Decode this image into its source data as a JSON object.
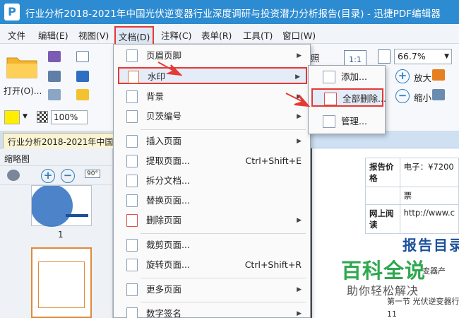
{
  "window": {
    "logo": "P",
    "title": "行业分析2018-2021年中国光伏逆变器行业深度调研与投资潜力分析报告(目录) - 迅捷PDF编辑器"
  },
  "menubar": {
    "items": [
      "文件",
      "编辑(E)",
      "视图(V)",
      "文档(D)",
      "注释(C)",
      "表单(R)",
      "工具(T)",
      "窗口(W)"
    ]
  },
  "toolbar": {
    "open_label": "打开(O)...",
    "zoom_percent": "100%",
    "zoom_level": "66.7%",
    "zoom_in_label": "放大",
    "zoom_out_label": "缩小",
    "fit_badge": "1:1",
    "partial_label": "照",
    "highlight_color": "#ffee00"
  },
  "doc_tab": {
    "label": "行业分析2018-2021年中国光"
  },
  "thumbnail_panel": {
    "title": "缩略图",
    "rotate_badge": "90°",
    "page_number": "1"
  },
  "document": {
    "table": [
      {
        "key": "报告价格",
        "value": "电子：¥7200"
      },
      {
        "key": "",
        "value": "票"
      },
      {
        "key": "网上阅读",
        "value": "http://www.c"
      }
    ],
    "heading": "报告目录",
    "fragment_1": "变器产",
    "fragment_2": "第一节 光伏逆变器行",
    "fragment_3": "11"
  },
  "watermark_brand": {
    "title": "百科全说",
    "subtitle": "助你轻松解决"
  },
  "dropdown": {
    "items": [
      {
        "label": "页眉页脚",
        "submenu": true
      },
      {
        "label": "水印",
        "submenu": true
      },
      {
        "label": "背景",
        "submenu": true
      },
      {
        "label": "贝茨编号",
        "submenu": true
      },
      {
        "label": "插入页面",
        "submenu": true
      },
      {
        "label": "提取页面...",
        "shortcut": "Ctrl+Shift+E"
      },
      {
        "label": "拆分文档..."
      },
      {
        "label": "替换页面..."
      },
      {
        "label": "删除页面",
        "submenu": true
      },
      {
        "label": "裁剪页面..."
      },
      {
        "label": "旋转页面...",
        "shortcut": "Ctrl+Shift+R"
      },
      {
        "label": "更多页面",
        "submenu": true
      },
      {
        "label": "数字签名",
        "submenu": true
      }
    ]
  },
  "submenu": {
    "items": [
      {
        "label": "添加..."
      },
      {
        "label": "全部删除..."
      },
      {
        "label": "管理..."
      }
    ]
  },
  "colors": {
    "title_bar": "#2d8bd1",
    "highlight_border": "#e53935",
    "brand_green": "#2fa84f",
    "heading_blue": "#1a4f9a"
  }
}
